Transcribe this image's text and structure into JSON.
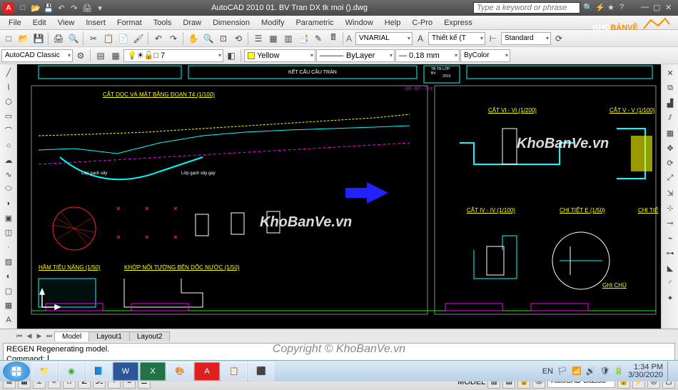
{
  "app": {
    "title": "AutoCAD 2010   01. BV Tran DX tk moi ().dwg",
    "search_placeholder": "Type a keyword or phrase"
  },
  "menus": [
    "File",
    "Edit",
    "View",
    "Insert",
    "Format",
    "Tools",
    "Draw",
    "Dimension",
    "Modify",
    "Parametric",
    "Window",
    "Help",
    "C-Pro",
    "Express"
  ],
  "workspace": "AutoCAD Classic",
  "layer_combo": "□ 7",
  "layer_color_combo": "Yellow",
  "linetype_combo": "ByLayer",
  "lineweight_combo": "0.18 mm",
  "plotstyle_combo": "ByColor",
  "font_combo": "VNARIAL",
  "textstyle_combo": "Thiết kế (T",
  "dimstyle_combo": "Standard",
  "layout_tabs": [
    "Model",
    "Layout1",
    "Layout2"
  ],
  "command": {
    "history": "REGEN Regenerating model.",
    "prompt": "Command:"
  },
  "statusbar": {
    "workspace": "AutoCAD Classic",
    "lang": "EN"
  },
  "clock": {
    "time": "1:34 PM",
    "date": "3/30/2020"
  },
  "drawing": {
    "title_top": "KẾT CẤU CẦU TRÀN",
    "label1": "CẮT DỌC VÀ MẶT BẰNG ĐOẠN T4 (1/100)",
    "label_ham": "HẦM TIÊU NĂNG (1/50)",
    "label_khop": "KHỚP NỐI TƯỜNG BÊN DỐC NƯỚC (1/50)",
    "label_cat6": "CẮT VI - VI (1/200)",
    "label_cat5": "CẮT V - V (1/100)",
    "label_cat4": "CẮT IV - IV (1/100)",
    "label_chitiet": "CHI TIẾT E (1/50)",
    "label_chitie2": "CHI TIẾ",
    "label_ghichu": "GHI CHÚ",
    "note1": "Lớp gạch xây",
    "note2": "Lớp gạch xây gáy",
    "tb_label": "TB-TB-LỚP\nBV",
    "tb_year": "2019",
    "dim_tb": "DĐ - ĐT - TK1"
  },
  "watermarks": {
    "wm": "KhoBanVe.vn",
    "logo1": "KHO",
    "logo2": "BẢNVẼ",
    "copyright": "Copyright © KhoBanVe.vn"
  }
}
